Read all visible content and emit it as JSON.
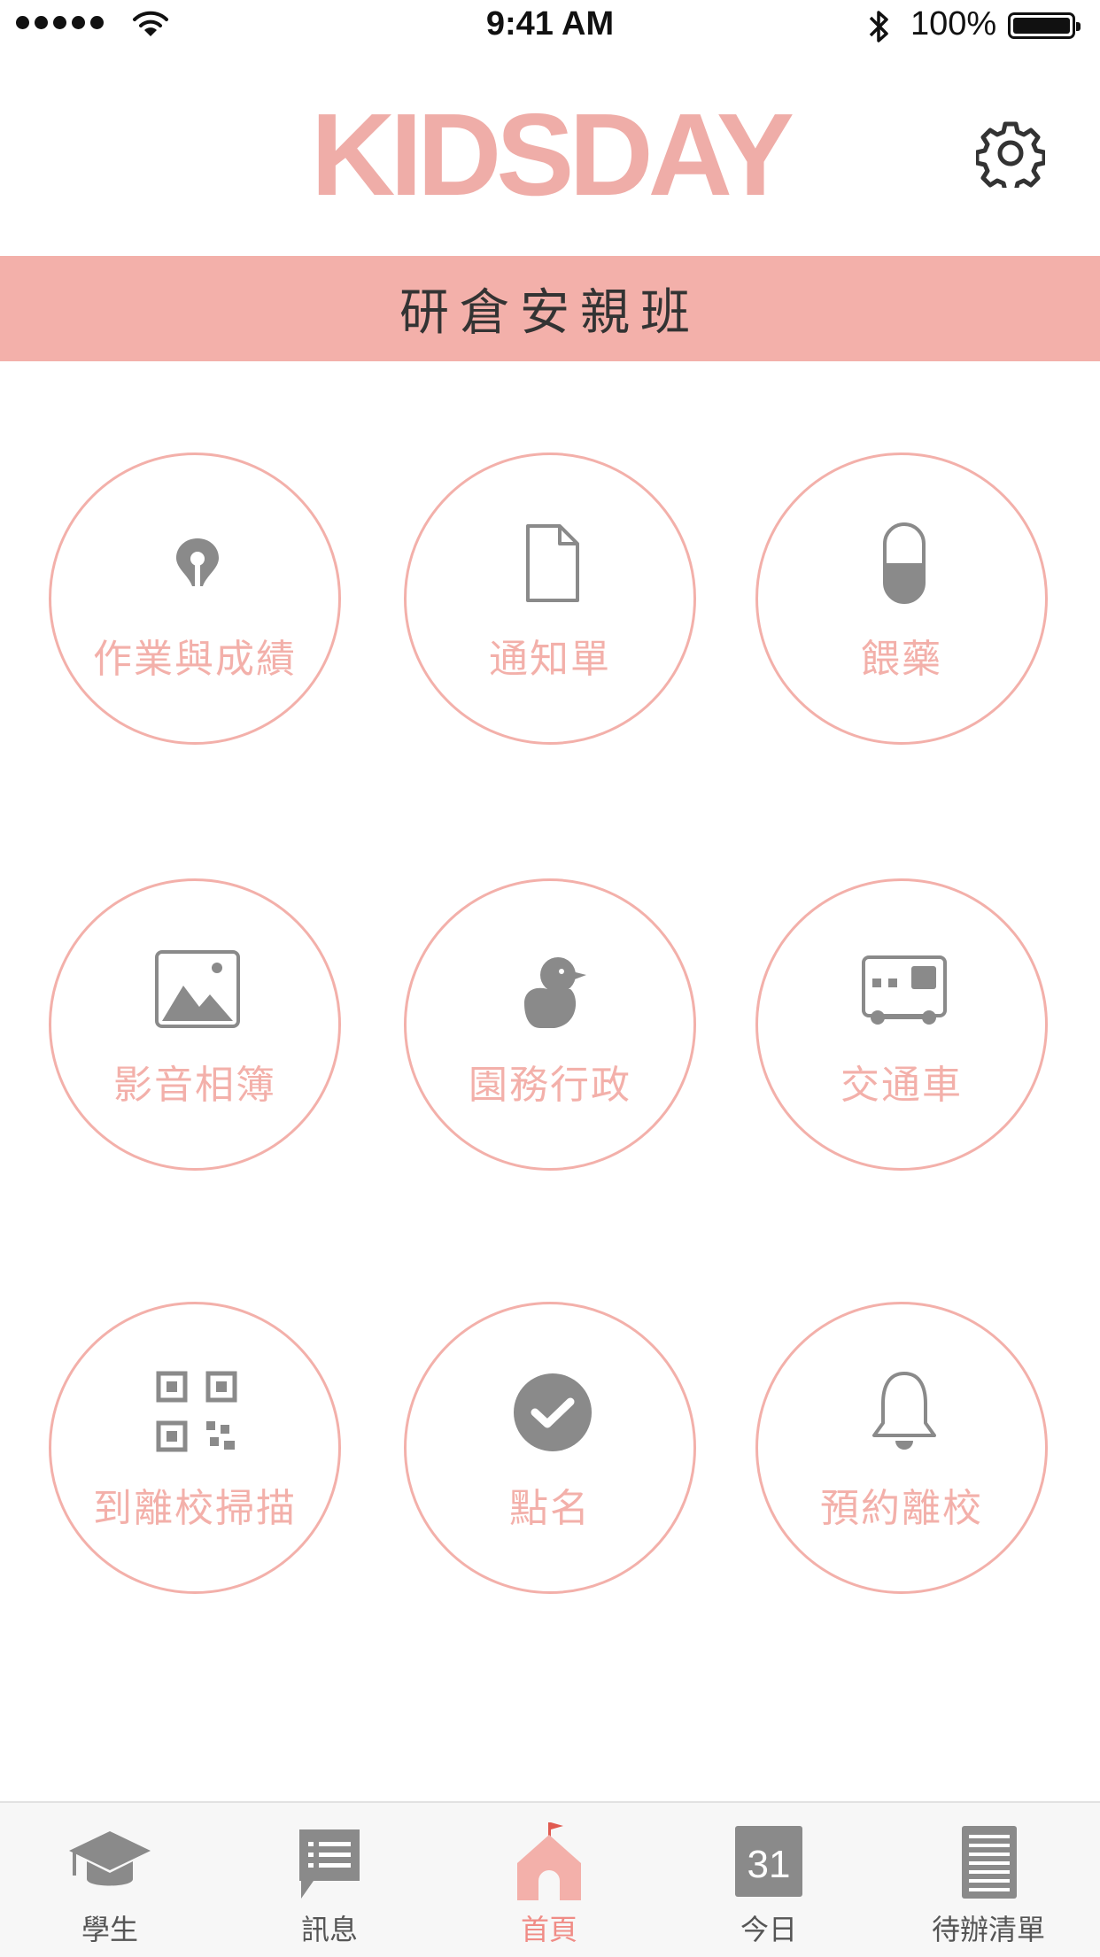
{
  "status_bar": {
    "time": "9:41 AM",
    "battery": "100%"
  },
  "header": {
    "logo": "KIDSDAY",
    "banner_title": "研倉安親班"
  },
  "grid": [
    {
      "label": "作業與成績",
      "icon": "pen-nib-icon"
    },
    {
      "label": "通知單",
      "icon": "document-icon"
    },
    {
      "label": "餵藥",
      "icon": "pill-icon"
    },
    {
      "label": "影音相簿",
      "icon": "photo-icon"
    },
    {
      "label": "園務行政",
      "icon": "duck-icon"
    },
    {
      "label": "交通車",
      "icon": "bus-icon"
    },
    {
      "label": "到離校掃描",
      "icon": "qr-code-icon"
    },
    {
      "label": "點名",
      "icon": "check-circle-icon"
    },
    {
      "label": "預約離校",
      "icon": "bell-icon"
    }
  ],
  "tabs": [
    {
      "label": "學生",
      "icon": "graduation-cap-icon"
    },
    {
      "label": "訊息",
      "icon": "message-icon"
    },
    {
      "label": "首頁",
      "icon": "home-flag-icon",
      "active": true
    },
    {
      "label": "今日",
      "icon": "calendar-icon",
      "day": "31"
    },
    {
      "label": "待辦清單",
      "icon": "list-icon"
    }
  ],
  "colors": {
    "accent": "#f3b0aa",
    "logo": "#efada8",
    "icon_gray": "#8a8a8a",
    "active_tab": "#f08c86"
  }
}
